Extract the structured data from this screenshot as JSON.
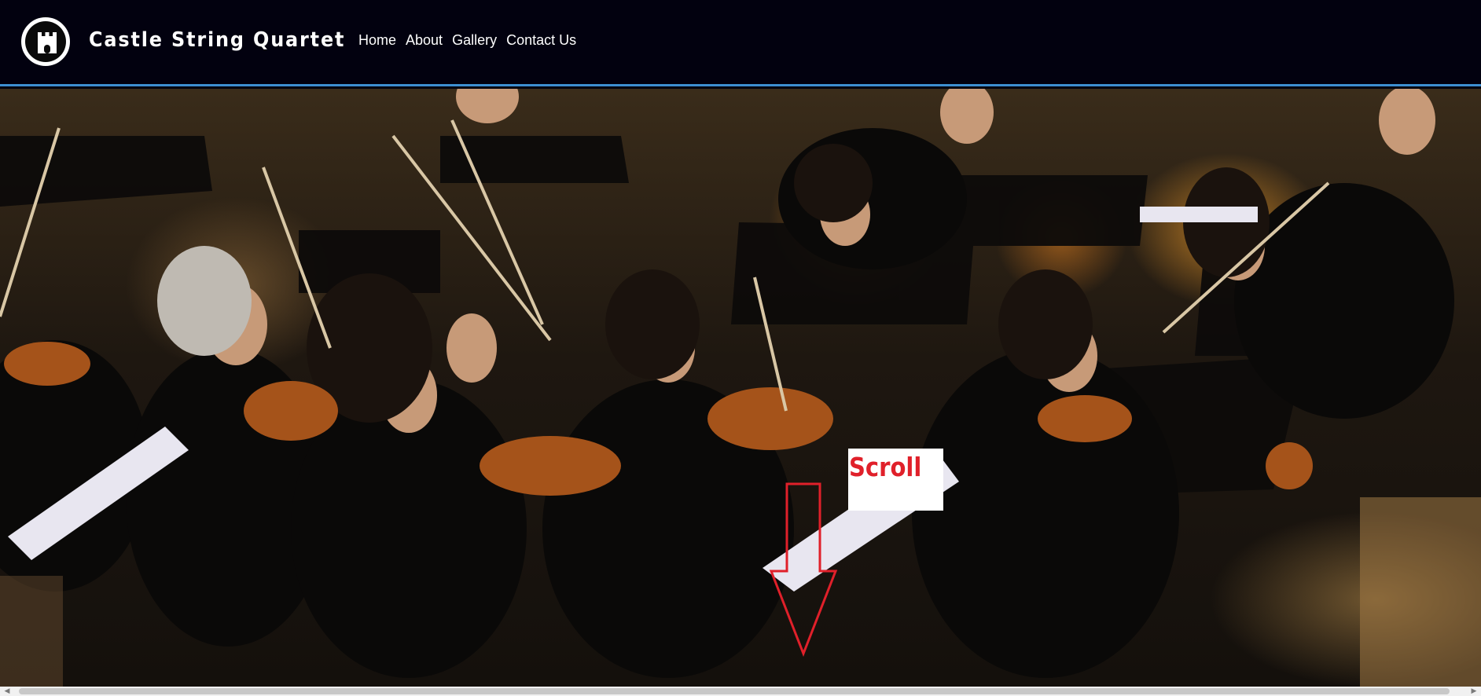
{
  "header": {
    "site_title": "Castle String Quartet",
    "logo_icon": "castle-icon",
    "nav": [
      "Home",
      "About",
      "Gallery",
      "Contact Us"
    ]
  },
  "hero": {
    "image": "orchestra-violinists-photo",
    "annotation": "Scroll",
    "annotation_color": "#e0202a",
    "arrow_icon": "down-arrow-icon"
  },
  "colors": {
    "header_bg": "#02010f",
    "header_border": "#3d8fd1",
    "text": "#ffffff"
  },
  "scrollbar": {
    "orientation": "horizontal",
    "left_icon": "chevron-left-icon",
    "right_icon": "chevron-right-icon"
  }
}
